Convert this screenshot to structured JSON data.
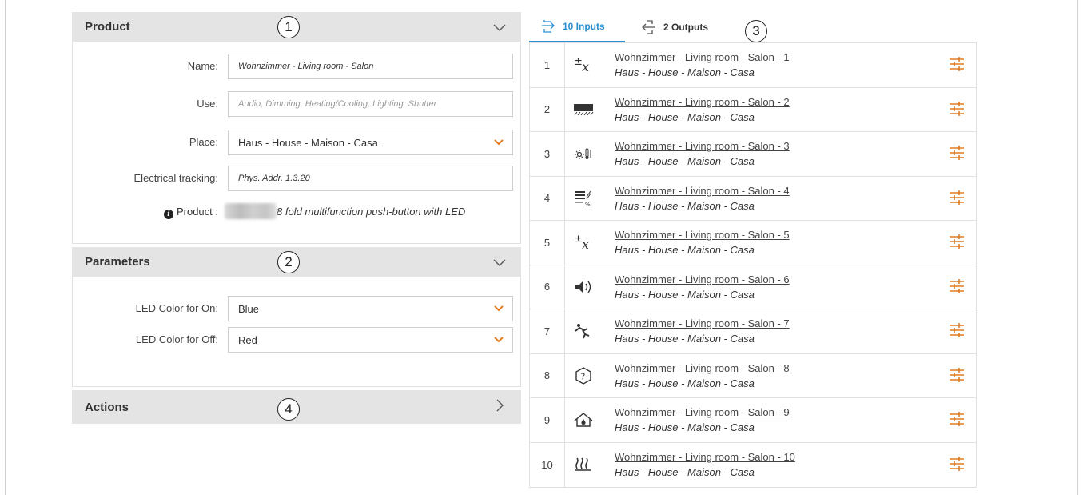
{
  "product": {
    "title": "Product",
    "callout": "1",
    "fields": [
      {
        "label": "Name:",
        "value": "Wohnzimmer - Living room - Salon"
      },
      {
        "label": "Use:",
        "placeholder": "Audio, Dimming, Heating/Cooling, Lighting, Shutter"
      },
      {
        "label": "Place:",
        "value": "Haus - House - Maison - Casa"
      },
      {
        "label": "Electrical tracking:",
        "value": "Phys. Addr. 1.3.20"
      }
    ],
    "product_label": "Product :",
    "product_value": "8 fold multifunction push-button with LED"
  },
  "parameters": {
    "title": "Parameters",
    "callout": "2",
    "fields": [
      {
        "label": "LED Color for On:",
        "value": "Blue"
      },
      {
        "label": "LED Color for Off:",
        "value": "Red"
      }
    ]
  },
  "actions": {
    "title": "Actions",
    "callout": "4"
  },
  "tabs": {
    "inputs_label": "10 Inputs",
    "outputs_label": "2 Outputs",
    "callout": "3"
  },
  "inputs": [
    {
      "num": "1",
      "icon": "plus-minus-x-icon",
      "title": "Wohnzimmer - Living room - Salon - 1",
      "sub": "Haus - House - Maison - Casa"
    },
    {
      "num": "2",
      "icon": "shutter-icon",
      "title": "Wohnzimmer - Living room - Salon - 2",
      "sub": "Haus - House - Maison - Casa"
    },
    {
      "num": "3",
      "icon": "sun-thermometer-icon",
      "title": "Wohnzimmer - Living room - Salon - 3",
      "sub": "Haus - House - Maison - Casa"
    },
    {
      "num": "4",
      "icon": "blind-percent-icon",
      "title": "Wohnzimmer - Living room - Salon - 4",
      "sub": "Haus - House - Maison - Casa"
    },
    {
      "num": "5",
      "icon": "plus-minus-x-icon",
      "title": "Wohnzimmer - Living room - Salon - 5",
      "sub": "Haus - House - Maison - Casa"
    },
    {
      "num": "6",
      "icon": "speaker-icon",
      "title": "Wohnzimmer - Living room - Salon - 6",
      "sub": "Haus - House - Maison - Casa"
    },
    {
      "num": "7",
      "icon": "scene-person-icon",
      "title": "Wohnzimmer - Living room - Salon - 7",
      "sub": "Haus - House - Maison - Casa"
    },
    {
      "num": "8",
      "icon": "unknown-question-icon",
      "title": "Wohnzimmer - Living room - Salon - 8",
      "sub": "Haus - House - Maison - Casa"
    },
    {
      "num": "9",
      "icon": "house-drop-icon",
      "title": "Wohnzimmer - Living room - Salon - 9",
      "sub": "Haus - House - Maison - Casa"
    },
    {
      "num": "10",
      "icon": "floor-heating-icon",
      "title": "Wohnzimmer - Living room - Salon - 10",
      "sub": "Haus - House - Maison - Casa"
    }
  ],
  "colors": {
    "accent_blue": "#2a8fd0",
    "accent_orange": "#e07b20",
    "header_gray": "#e4e4e4"
  }
}
